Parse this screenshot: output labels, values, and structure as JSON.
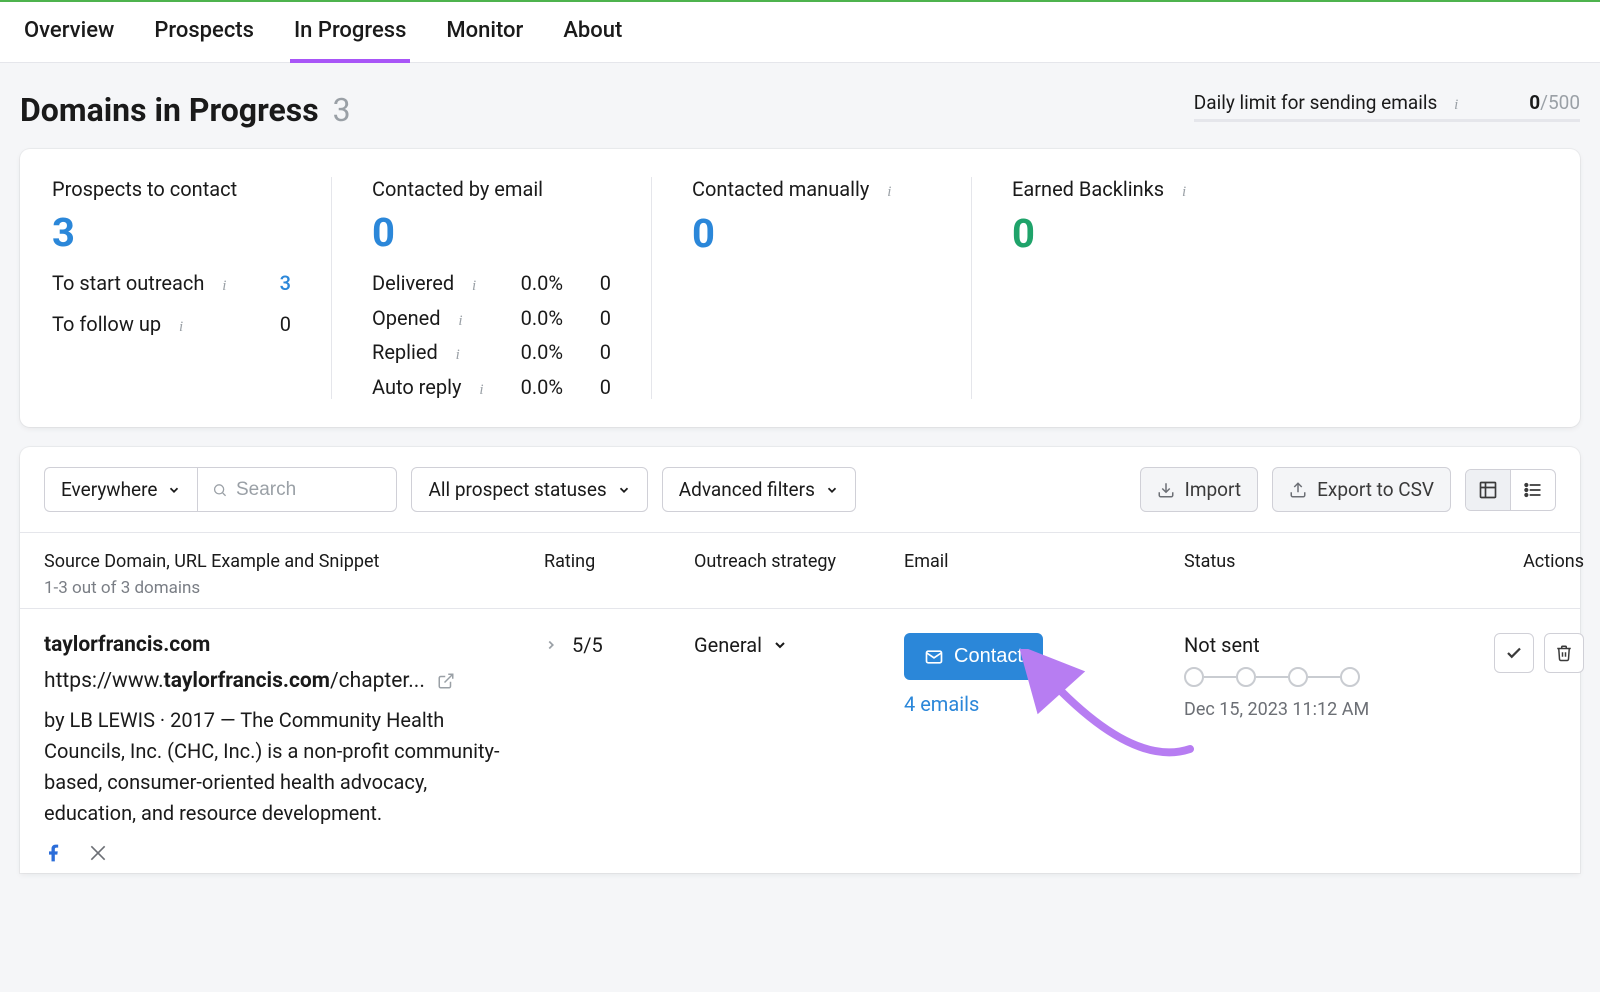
{
  "tabs": [
    "Overview",
    "Prospects",
    "In Progress",
    "Monitor",
    "About"
  ],
  "active_tab_index": 2,
  "page": {
    "title": "Domains in Progress",
    "count": "3"
  },
  "limit": {
    "label": "Daily limit for sending emails",
    "used": "0",
    "total": "/500"
  },
  "stats": {
    "prospects": {
      "label": "Prospects to contact",
      "value": "3",
      "sub": [
        {
          "label": "To start outreach",
          "count": "3",
          "count_class": "b"
        },
        {
          "label": "To follow up",
          "count": "0",
          "count_class": ""
        }
      ]
    },
    "contacted_email": {
      "label": "Contacted by email",
      "value": "0",
      "sub": [
        {
          "label": "Delivered",
          "pct": "0.0%",
          "count": "0"
        },
        {
          "label": "Opened",
          "pct": "0.0%",
          "count": "0"
        },
        {
          "label": "Replied",
          "pct": "0.0%",
          "count": "0"
        },
        {
          "label": "Auto reply",
          "pct": "0.0%",
          "count": "0"
        }
      ]
    },
    "contacted_manually": {
      "label": "Contacted manually",
      "value": "0"
    },
    "earned_backlinks": {
      "label": "Earned Backlinks",
      "value": "0"
    }
  },
  "filters": {
    "scope": "Everywhere",
    "search_placeholder": "Search",
    "status_filter": "All prospect statuses",
    "advanced": "Advanced filters",
    "import": "Import",
    "export": "Export to CSV"
  },
  "table": {
    "headers": {
      "source": "Source Domain, URL Example and Snippet",
      "source_sub": "1-3 out of 3 domains",
      "rating": "Rating",
      "strategy": "Outreach strategy",
      "email": "Email",
      "status": "Status",
      "actions": "Actions"
    },
    "rows": [
      {
        "domain": "taylorfrancis.com",
        "url_prefix": "https://www.",
        "url_bold": "taylorfrancis.com",
        "url_suffix": "/chapter...",
        "snippet": "by LB LEWIS · 2017 — The Community Health Councils, Inc. (CHC, Inc.) is a non-profit community-based, consumer-oriented health advocacy, education, and resource development.",
        "rating": "5/5",
        "strategy": "General",
        "contact_label": "Contact",
        "email_count": "4 emails",
        "status_label": "Not sent",
        "status_date": "Dec 15, 2023 11:12 AM"
      }
    ]
  }
}
